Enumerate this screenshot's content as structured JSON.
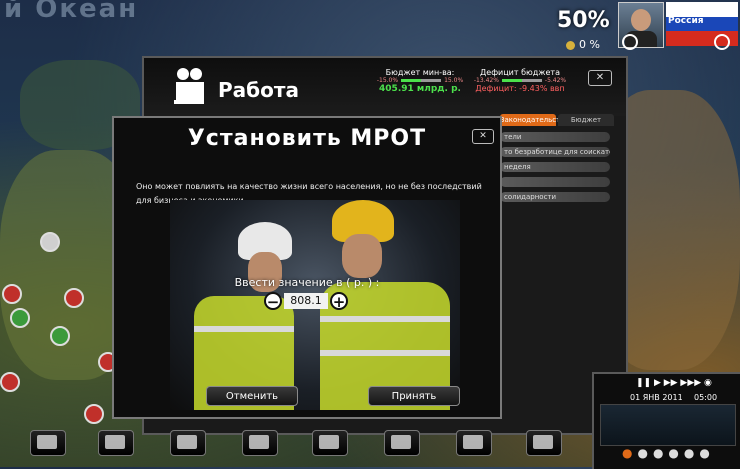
{
  "map": {
    "ocean_label": "й Океан"
  },
  "hud": {
    "approval": "50%",
    "sub_value": "0 %",
    "country": "Россия",
    "colors": {
      "flag_white": "#ffffff",
      "flag_blue": "#1a47b8",
      "flag_red": "#d52b1e"
    }
  },
  "work_panel": {
    "title": "Работа",
    "ministry_budget_label": "Бюджет мин-ва:",
    "ministry_budget_left": "-15.0%",
    "ministry_budget_right": "15.0%",
    "ministry_budget_value": "405.91 млрд. р.",
    "deficit_label": "Дефицит бюджета",
    "deficit_left": "-13.42%",
    "deficit_right": "-5.42%",
    "deficit_value": "Дефицит: -9.43% ввп",
    "close_icon": "close-icon",
    "tabs": [
      "Законодательство",
      "Бюджет"
    ],
    "law_items": [
      "тели",
      "то безработице для соискателе",
      "неделя",
      "",
      "солидарности"
    ]
  },
  "modal": {
    "title": "Установить МРОТ",
    "description": "Оно может повлиять на качество жизни всего населения, но не без последствий для бизнеса и экономики.",
    "input_label": "Ввести значение в ( р. ) :",
    "value": "808.1",
    "minus_icon": "minus-icon",
    "plus_icon": "plus-icon",
    "cancel_label": "Отменить",
    "accept_label": "Принять"
  },
  "controls": {
    "date": "01 ЯНВ 2011",
    "time": "05:00"
  },
  "bottom_bar": {
    "icons": [
      "industry-icon",
      "environment-icon",
      "finance-icon",
      "transport-icon",
      "science-icon",
      "security-icon",
      "government-icon",
      "diplomacy-icon",
      "culture-icon"
    ]
  }
}
